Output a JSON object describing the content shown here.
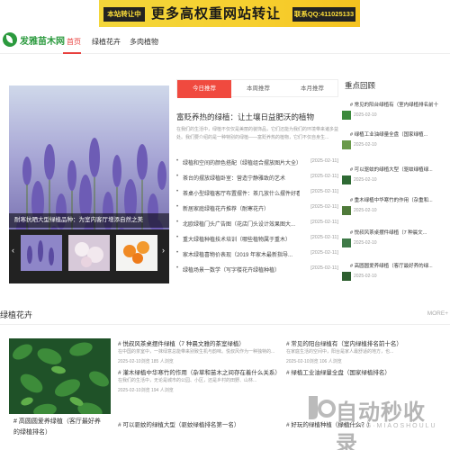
{
  "banner": {
    "left_tag": "本站转让中",
    "main_text": "更多高权重网站转让",
    "right_tag": "联系QQ:411025133"
  },
  "nav": {
    "logo_text": "发雅苗木网",
    "items": [
      "首页",
      "绿植花卉",
      "多肉植物"
    ]
  },
  "slider": {
    "caption": "耐寒抗晒大型绿植品种：为室内客厅增添自然之美",
    "prev": "‹",
    "next": "›"
  },
  "tabs": [
    "今日推荐",
    "本周推荐",
    "本月推荐"
  ],
  "headline": "富贬养热的绿植：让土壤日益肥沃的植物",
  "summary": "在我们的生活中，绿植不仅仅是美丽的装饰品，它们还能为我们的环境带来诸多益处。我们要介绍的是一种特别的绿植——富贬养热的植物，它们不仅自身生...",
  "news": [
    {
      "title": "绿植和空间的颜色搭配（绿植组合摆放图片大全）",
      "date": "[2025-02-11]"
    },
    {
      "title": "茶台的摆放绿植卧室：营造宁静雅致的艺术",
      "date": "[2025-02-11]"
    },
    {
      "title": "茶桌小型绿植客厅布置摆件：茶几放什么摆件好看",
      "date": "[2025-02-11]"
    },
    {
      "title": "新居家庭绿植花卉推荐（耐寒花卉）",
      "date": "[2025-02-11]"
    },
    {
      "title": "北欧绿植门头广告图（花店门头设计效果图大...",
      "date": "[2025-02-11]"
    },
    {
      "title": "重大绿植种植技术培训（哪些植物属于重木）",
      "date": "[2025-02-11]"
    },
    {
      "title": "家木绿植喜物价表现（2019 年家木最新指导...",
      "date": "[2025-02-11]"
    },
    {
      "title": "绿植场景一数学（写字楼花卉绿植种植）",
      "date": "[2025-02-11]"
    }
  ],
  "sidebar": {
    "title": "重点回顾",
    "items": [
      {
        "title": "# 常见的阳台绿植有（室内绿植排名前十",
        "date": "2025-02-10"
      },
      {
        "title": "# 绿植工业油绿量全盘（国家绿植...",
        "date": "2025-02-10"
      },
      {
        "title": "# 可以驱蚊的绿植大型（驱蚊绿植绿...",
        "date": "2025-02-10"
      },
      {
        "title": "# 重木绿植中华寒竹的作用（杂重和...",
        "date": "2025-02-10"
      },
      {
        "title": "# 悦叔风茶桌摆件绿植（7 种晨文...",
        "date": "2025-02-10"
      },
      {
        "title": "# 高圆圆爱养绿植（客厅最好养的绿...",
        "date": "2025-02-10"
      }
    ]
  },
  "section": {
    "title": "绿植花卉",
    "more": "MORE+"
  },
  "card": {
    "caption": "# 高圆圆爱养绿植（客厅最好养的绿植排名）"
  },
  "card_list_left": [
    {
      "title": "# 悦叔风茶桌摆件绿植（7 种晨文雅的茶室绿植）",
      "desc": "在中国的茶室中，一抹绿意总能带来别致生机与韵味。悦叔风作为一种独特的...",
      "meta": "2025-02-10浏览  185 人浏览"
    },
    {
      "title": "# 灌木绿植中华寒竹的作用（杂草和苗木之间存在着什么关系）",
      "desc": "在我们的生活中，无论是城市的公园、小区，还是乡村的田野、山林...",
      "meta": "2025-02-10浏览  194 人浏览"
    },
    {
      "title": "# 可以驱蚊的绿植大型（驱蚊绿植排名第一名）",
      "desc": "",
      "meta": ""
    }
  ],
  "card_list_right": [
    {
      "title": "# 常见的阳台绿植有（室内绿植排名前十名）",
      "desc": "在家庭生活的空间中，阳台是家人最舒适的地方，也...",
      "meta": "2025-02-10浏览  106 人浏览"
    },
    {
      "title": "# 绿植工业油绿量全盘（国家绿植排名）",
      "desc": "",
      "meta": ""
    },
    {
      "title": "# 好玩的绿植种植（绿植什么？）",
      "desc": "",
      "meta": ""
    }
  ],
  "watermark": {
    "title": "自动秒收录",
    "subtitle": "ZIDONG·MIAOSHOULU"
  },
  "colors": {
    "accent": "#e8403e",
    "brand_green": "#2b9a3e",
    "banner_yellow": "#f3d63a"
  }
}
